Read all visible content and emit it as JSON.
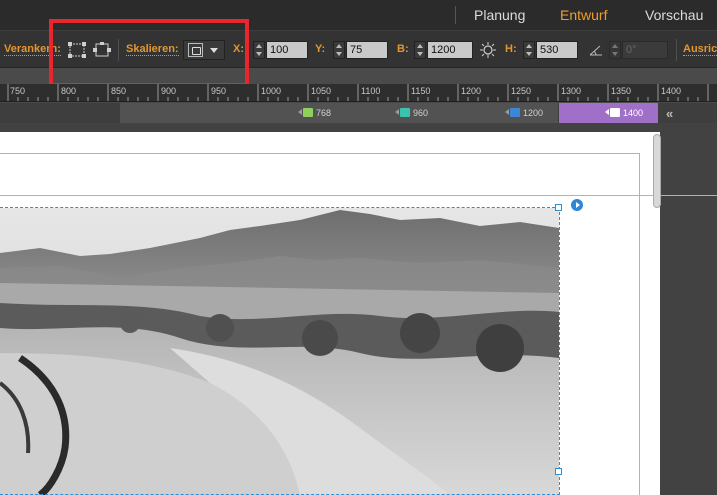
{
  "modes": [
    {
      "label": "Planung",
      "active": false
    },
    {
      "label": "Entwurf",
      "active": true
    },
    {
      "label": "Vorschau",
      "active": false
    }
  ],
  "control_bar": {
    "anchor_label": "Verankern:",
    "anchor_icons": [
      "anchor-position-icon",
      "anchor-resize-icon"
    ],
    "scale_label": "Skalieren:",
    "scale_dropdown_icon": "lock-proportions-icon",
    "x_label": "X:",
    "x_value": "100",
    "y_label": "Y:",
    "y_value": "75",
    "w_label": "B:",
    "w_value": "1200",
    "link_icon": "link-dimensions-icon",
    "h_label": "H:",
    "h_value": "530",
    "angle_icon": "rotation-angle-icon",
    "angle_value": "0°",
    "align_label": "Ausric"
  },
  "ruler": {
    "labels": [
      "750",
      "800",
      "850",
      "900",
      "950",
      "1000",
      "1050",
      "1100",
      "1150",
      "1200",
      "1250",
      "1300",
      "1350",
      "1400"
    ]
  },
  "breakpoints": [
    {
      "label": "768",
      "color": "#8fcf5c"
    },
    {
      "label": "960",
      "color": "#3ac4b0"
    },
    {
      "label": "1200",
      "color": "#3b87d6"
    },
    {
      "label": "1400",
      "color": "#ffffff",
      "active": true,
      "bar_color": "#a070c8"
    }
  ],
  "colors": {
    "accent_orange": "#e3962f",
    "highlight_red": "#e8262b",
    "selection_blue": "#2b8fd6"
  }
}
